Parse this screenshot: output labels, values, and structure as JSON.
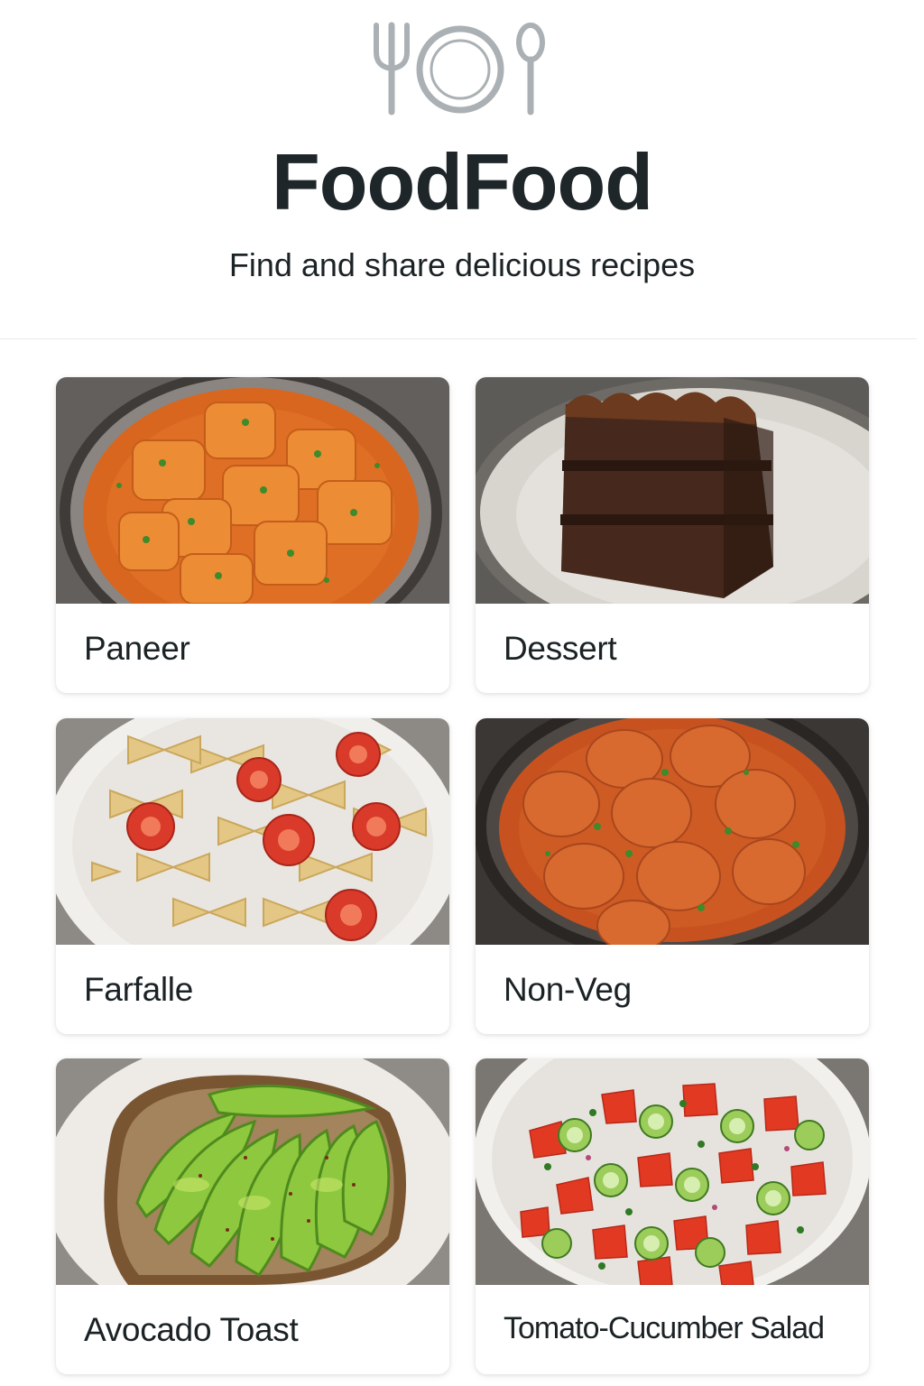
{
  "app": {
    "title": "FoodFood",
    "tagline": "Find and share delicious recipes",
    "logo_icon": "fork-plate-spoon-icon",
    "icon_color": "#aab0b3"
  },
  "categories": [
    {
      "label": "Paneer",
      "image": "paneer-curry-bowl"
    },
    {
      "label": "Dessert",
      "image": "chocolate-layer-cake-slice"
    },
    {
      "label": "Farfalle",
      "image": "farfalle-pasta-with-tomatoes"
    },
    {
      "label": "Non-Veg",
      "image": "chicken-curry-bowl"
    },
    {
      "label": "Avocado Toast",
      "image": "avocado-toast-plate"
    },
    {
      "label": "Tomato-Cucumber Salad",
      "image": "tomato-cucumber-salad-bowl"
    }
  ],
  "colors": {
    "text": "#1f2629",
    "divider": "#e8eaec",
    "card_background": "#ffffff"
  }
}
